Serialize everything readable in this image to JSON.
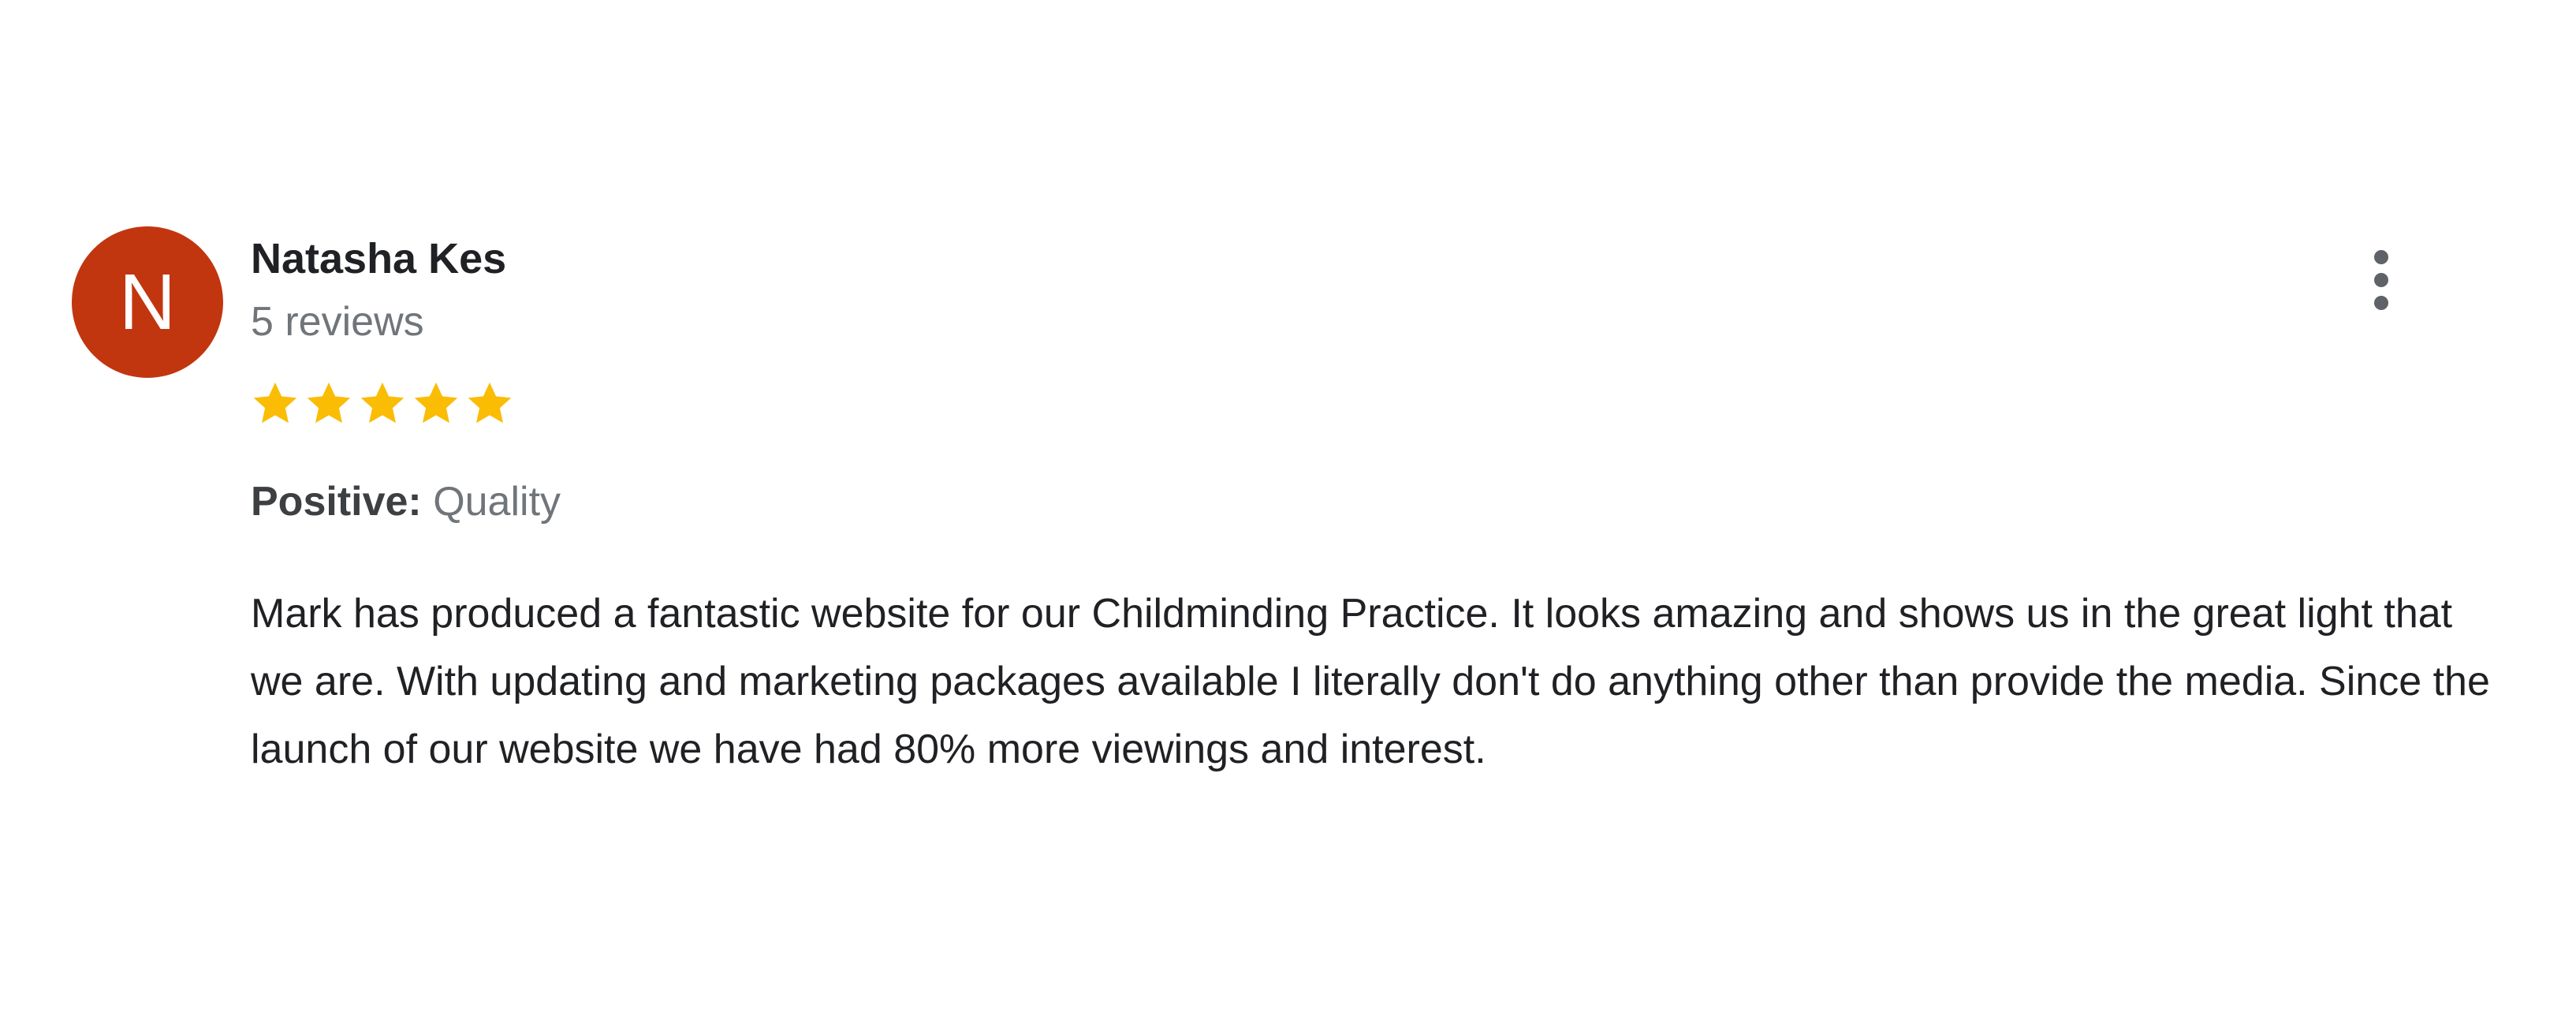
{
  "review": {
    "avatar_letter": "N",
    "avatar_color": "#c1360f",
    "author_name": "Natasha Kes",
    "review_count": "5 reviews",
    "rating": 5,
    "rating_max": 5,
    "star_color": "#fbbc04",
    "attribute_label": "Positive:",
    "attribute_value": "Quality",
    "text": "Mark has produced a fantastic website for our Childminding Practice. It looks amazing and shows us in the great light that we are. With updating and marketing packages available I literally don't do anything other than provide the media. Since the launch of our website we have had 80% more viewings and interest.",
    "more_icon": "more-vert-icon"
  }
}
